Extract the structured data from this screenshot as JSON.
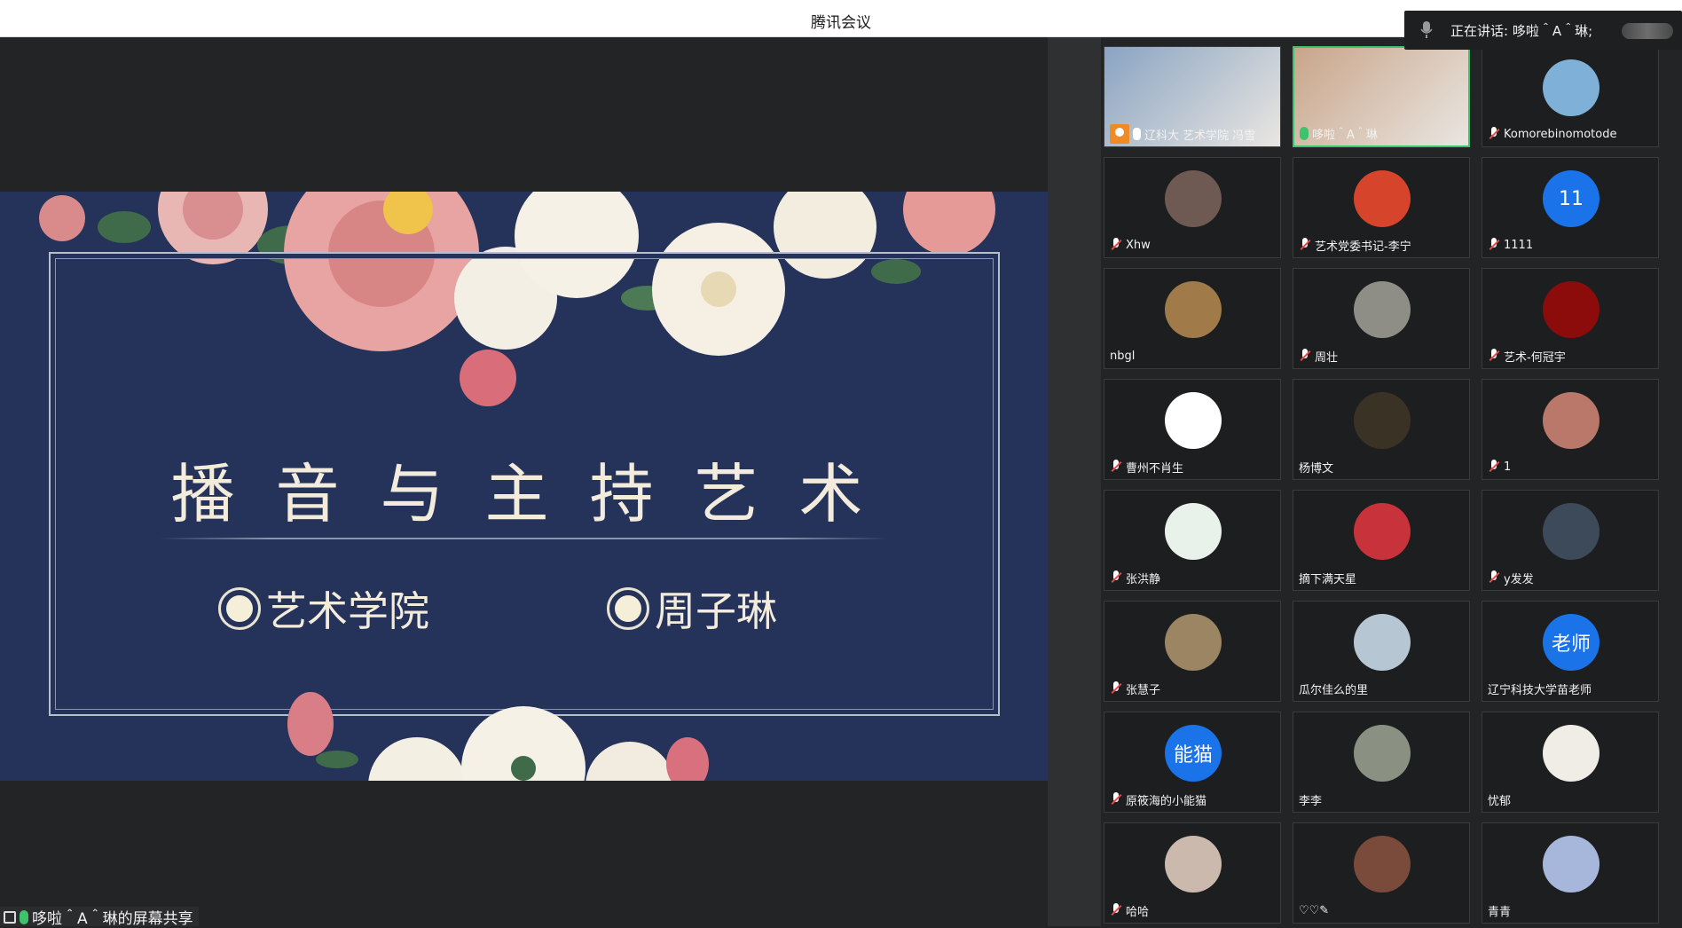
{
  "window": {
    "title": "腾讯会议"
  },
  "speaking": {
    "text": "正在讲话: 哆啦＾A＾琳;"
  },
  "slide": {
    "headline": "播音与主持艺术",
    "items": [
      "艺术学院",
      "周子琳"
    ]
  },
  "share_caption": "哆啦＾A＾琳的屏幕共享",
  "participants": [
    {
      "name": "辽科大 艺术学院 冯雪",
      "mic": "on-white",
      "avatar_text": "",
      "color": "#8aa4c2"
    },
    {
      "name": "哆啦＾A＾琳",
      "mic": "on",
      "avatar_text": "",
      "color": "#c9a58a"
    },
    {
      "name": "Komorebinomotode",
      "mic": "muted",
      "avatar_text": "",
      "color": "#7fb0d8"
    },
    {
      "name": "Xhw",
      "mic": "muted",
      "avatar_text": "",
      "color": "#6e5a52"
    },
    {
      "name": "艺术党委书记-李宁",
      "mic": "muted",
      "avatar_text": "",
      "color": "#d6452b"
    },
    {
      "name": "1111",
      "mic": "muted",
      "avatar_text": "11",
      "color": "#1a73e8"
    },
    {
      "name": "nbgl",
      "mic": "none",
      "avatar_text": "",
      "color": "#a07a48"
    },
    {
      "name": "周壮",
      "mic": "muted",
      "avatar_text": "",
      "color": "#8f8e86"
    },
    {
      "name": "艺术-何冠宇",
      "mic": "muted",
      "avatar_text": "",
      "color": "#8c0b0b"
    },
    {
      "name": "曹州不肖生",
      "mic": "muted",
      "avatar_text": "",
      "color": "#ffffff"
    },
    {
      "name": "杨博文",
      "mic": "none",
      "avatar_text": "",
      "color": "#3a3225"
    },
    {
      "name": "1",
      "mic": "muted",
      "avatar_text": "",
      "color": "#b9786a"
    },
    {
      "name": "张洪静",
      "mic": "muted",
      "avatar_text": "",
      "color": "#e8f2ea"
    },
    {
      "name": "摘下满天星",
      "mic": "none",
      "avatar_text": "",
      "color": "#c8323a"
    },
    {
      "name": "y发发",
      "mic": "muted",
      "avatar_text": "",
      "color": "#3d4a5a"
    },
    {
      "name": "张慧子",
      "mic": "muted",
      "avatar_text": "",
      "color": "#9b8563"
    },
    {
      "name": "瓜尔佳么的里",
      "mic": "none",
      "avatar_text": "",
      "color": "#b7c6d3"
    },
    {
      "name": "辽宁科技大学苗老师",
      "mic": "none",
      "avatar_text": "老师",
      "color": "#1a73e8"
    },
    {
      "name": "原筱海的小能猫",
      "mic": "muted",
      "avatar_text": "能猫",
      "color": "#1a73e8"
    },
    {
      "name": "李李",
      "mic": "none",
      "avatar_text": "",
      "color": "#8a9183"
    },
    {
      "name": "忧郁",
      "mic": "none",
      "avatar_text": "",
      "color": "#f0ece6"
    },
    {
      "name": "哈哈",
      "mic": "muted",
      "avatar_text": "",
      "color": "#cbb9ae"
    },
    {
      "name": "♡♡✎",
      "mic": "none",
      "avatar_text": "",
      "color": "#7a4a3a"
    },
    {
      "name": "青青",
      "mic": "none",
      "avatar_text": "",
      "color": "#a7b7dc"
    }
  ]
}
